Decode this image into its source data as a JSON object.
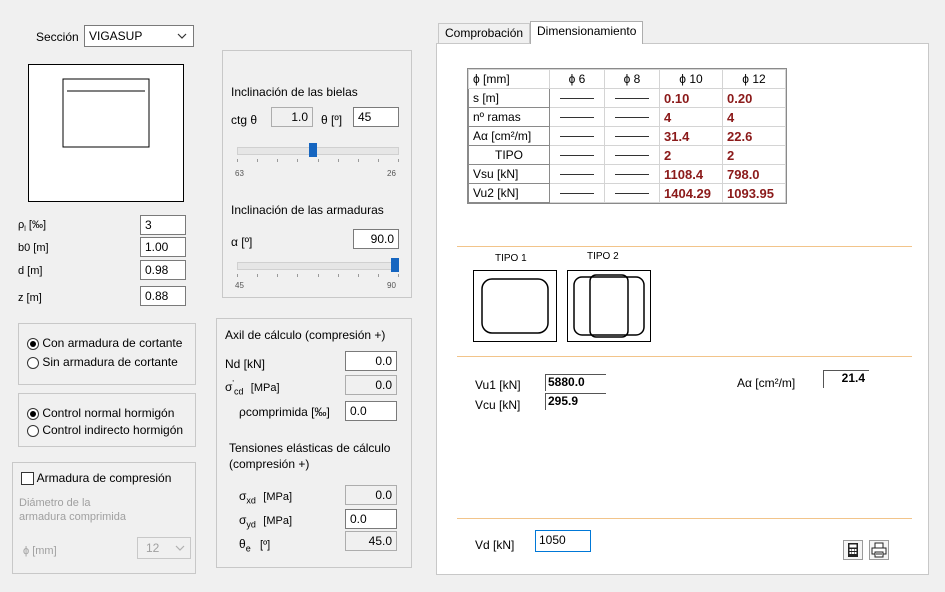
{
  "left": {
    "section_label": "Sección",
    "section_value": "VIGASUP",
    "params": [
      {
        "label": "ρ",
        "sub": "l",
        "unit": "[‰]",
        "value": "3"
      },
      {
        "label": "b0 [m]",
        "sub": "",
        "unit": "",
        "value": "1.00"
      },
      {
        "label": "d [m]",
        "sub": "",
        "unit": "",
        "value": "0.98"
      },
      {
        "label": "z [m]",
        "sub": "",
        "unit": "",
        "value": "0.88"
      }
    ],
    "radio_with": "Con armadura de cortante",
    "radio_without": "Sin armadura de cortante",
    "radio_normal": "Control normal hormigón",
    "radio_indirect": "Control indirecto hormigón",
    "compression_check": "Armadura de compresión",
    "diameter_label_1": "Diámetro de la",
    "diameter_label_2": "armadura comprimida",
    "diameter_unit": "ϕ  [mm]",
    "diameter_value": "12"
  },
  "middle": {
    "bielas_title": "Inclinación de las bielas",
    "ctg_label": "ctg θ",
    "ctg_value": "1.0",
    "theta_label": "θ [º]",
    "theta_value": "45",
    "slider1_min": "63",
    "slider1_max": "26",
    "slider1_level": 0.47,
    "arm_title": "Inclinación de las armaduras",
    "alpha_label": "α [º]",
    "alpha_value": "90.0",
    "slider2_min": "45",
    "slider2_max": "90",
    "slider2_level": 1.0,
    "axil_title": "Axil de cálculo (compresión +)",
    "nd_label": "Nd [kN]",
    "nd_value": "0.0",
    "scd_label": "σ",
    "scd_sub": "cd",
    "scd_sup": "'",
    "scd_unit": "[MPa]",
    "scd_value": "0.0",
    "rho_label": "ρcomprimida [‰]",
    "rho_value": "0.0",
    "tens_title_1": "Tensiones elásticas de cálculo",
    "tens_title_2": "(compresión +)",
    "sxd_label": "σ",
    "sxd_sub": "xd",
    "sxd_unit": "[MPa]",
    "sxd_value": "0.0",
    "syd_label": "σ",
    "syd_sub": "yd",
    "syd_unit": "[MPa]",
    "syd_value": "0.0",
    "te_label": "θ",
    "te_sub": "e",
    "te_unit": "[º]",
    "te_value": "45.0"
  },
  "right": {
    "tabs": [
      "Comprobación",
      "Dimensionamiento"
    ],
    "active_tab": 1,
    "table_header": [
      "ϕ   [mm]",
      "ϕ 6",
      "ϕ 8",
      "ϕ 10",
      "ϕ 12"
    ],
    "table_rows": [
      {
        "label": "s [m]",
        "c6": "",
        "c8": "",
        "c10": "0.10",
        "c12": "0.20"
      },
      {
        "label": "nº ramas",
        "c6": "",
        "c8": "",
        "c10": "4",
        "c12": "4"
      },
      {
        "label": "Aα [cm²/m]",
        "c6": "",
        "c8": "",
        "c10": "31.4",
        "c12": "22.6"
      },
      {
        "label": "TIPO",
        "c6": "",
        "c8": "",
        "c10": "2",
        "c12": "2"
      },
      {
        "label": "Vsu [kN]",
        "c6": "",
        "c8": "",
        "c10": "1108.4",
        "c12": "798.0"
      },
      {
        "label": "Vu2 [kN]",
        "c6": "",
        "c8": "",
        "c10": "1404.29",
        "c12": "1093.95"
      }
    ],
    "tipo1": "TIPO 1",
    "tipo2": "TIPO 2",
    "vu1_label": "Vu1 [kN]",
    "vu1_value": "5880.0",
    "vcu_label": "Vcu [kN]",
    "vcu_value": "295.9",
    "aalpha_label": "Aα  [cm²/m]",
    "aalpha_value": "21.4",
    "vd_label": "Vd  [kN]",
    "vd_value": "1050"
  }
}
